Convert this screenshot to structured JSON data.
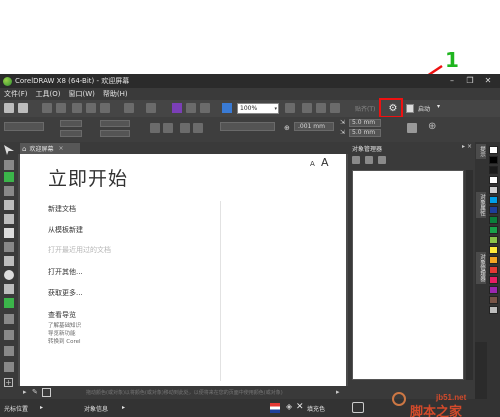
{
  "annotation": {
    "step_number": "1",
    "color": "#1fb51f",
    "highlight_color": "#ee1111"
  },
  "window": {
    "title": "CorelDRAW X8 (64-Bit) - 欢迎屏幕",
    "controls": {
      "minimize": "–",
      "restore": "❐",
      "close": "✕"
    }
  },
  "menu": [
    "文件(F)",
    "工具(O)",
    "窗口(W)",
    "帮助(H)"
  ],
  "toolbar": {
    "zoom_value": "100%",
    "snap_label": "贴齐(T)",
    "launch_label": "启动",
    "launch_dropdown": "▾",
    "gear_glyph": "⚙"
  },
  "property_bar": {
    "nudge_value": ".001 mm",
    "dup_x": "5.0 mm",
    "dup_y": "5.0 mm"
  },
  "document_tab": {
    "home_glyph": "⌂",
    "label": "欢迎屏幕",
    "close": "×"
  },
  "welcome": {
    "title": "立即开始",
    "font_small": "A",
    "font_large": "A",
    "links": {
      "new_document": "新建文档",
      "from_template": "从模板新建",
      "open_recent": "打开最近用过的文档",
      "open_other": "打开其他...",
      "get_more": "获取更多...",
      "view_tour": "查看导览"
    },
    "subs": {
      "learn_basics": "了解基础知识",
      "tour_new": "导览新功能",
      "switch_corel": "转换到 Corel"
    },
    "status_hint": "拖动颜色(或对象)以将颜色(或对象)移动到此处，以便将来在您的页面中使用颜色(或对象)"
  },
  "docker": {
    "title": "对象管理器",
    "controls": "▸ ×"
  },
  "right_tabs": [
    "提示",
    "对象属性",
    "对象管理器"
  ],
  "palette": [
    "#ffffff",
    "#000000",
    "#1a1a1a",
    "#ffffff",
    "#cfcfcf",
    "#00a0e9",
    "#1e3f9a",
    "#0b7f3b",
    "#19a24a",
    "#8bc34a",
    "#ffeb3b",
    "#f5a623",
    "#e53935",
    "#e91e63",
    "#9c27b0",
    "#795548",
    "#bdbdbd"
  ],
  "status": {
    "cursor_label": "光标位置",
    "cursor_arrow": "▸",
    "object_info": "对象信息",
    "fill_label": "填充色",
    "fill_none": "✕"
  },
  "watermark": {
    "url": "jb51.net",
    "brand": "脚本之家"
  }
}
